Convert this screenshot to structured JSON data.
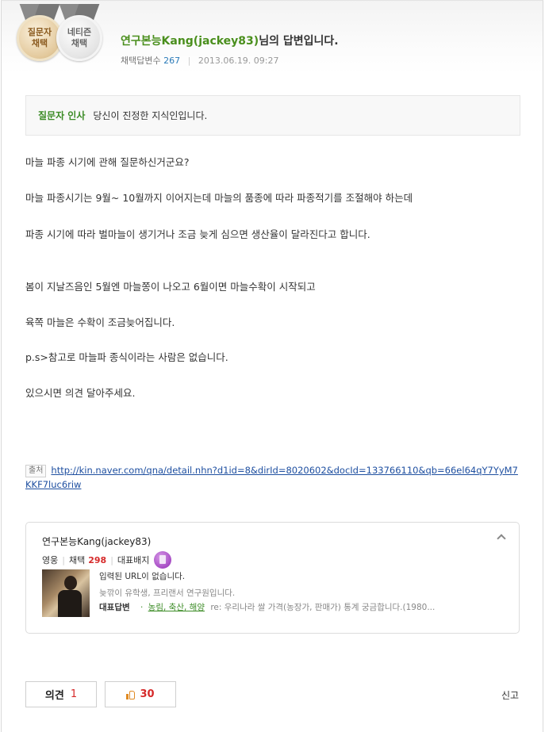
{
  "header": {
    "medals": [
      {
        "line1": "질문자",
        "line2": "채택"
      },
      {
        "line1": "네티즌",
        "line2": "채택"
      }
    ],
    "answerer_name": "연구본능Kang(jackey83)",
    "title_suffix": "님의 답변입니다.",
    "adopted_label": "채택답변수",
    "adopted_count": "267",
    "date": "2013.06.19.  09:27"
  },
  "greeting": {
    "label": "질문자 인사",
    "text": "당신이 진정한 지식인입니다."
  },
  "body": {
    "paragraphs": [
      "마늘 파종 시기에 관해 질문하신거군요?",
      "마늘 파종시기는 9월~ 10월까지 이어지는데 마늘의 품종에 따라 파종적기를 조절해야 하는데",
      "파종 시기에 따라 벌마늘이 생기거나 조금 늦게 심으면 생산율이 달라진다고 합니다.",
      "봄이 지날즈음인 5월엔 마늘쫑이 나오고 6월이면 마늘수확이 시작되고",
      "육쪽 마늘은 수확이 조금늦어집니다.",
      "p.s>참고로 마늘파 종식이라는 사람은 없습니다.",
      "있으시면 의견 달아주세요."
    ]
  },
  "source": {
    "tag": "출처",
    "url": "http://kin.naver.com/qna/detail.nhn?d1id=8&dirId=8020602&docId=133766110&qb=66el64qY7YyM7KKF7luc6riw"
  },
  "profile": {
    "name": "연구본능Kang(jackey83)",
    "rank": "영웅",
    "adopt_label": "채택",
    "adopt_count": "298",
    "badge_label": "대표배지",
    "badge_icon": "badge-icon",
    "url_text": "입력된 URL이 없습니다.",
    "intro": "늦깎이 유학생, 프리랜서 연구원입니다.",
    "rep_label": "대표답변",
    "rep_bullet": "·",
    "rep_category": "농림, 축산, 해양",
    "rep_question": "re: 우리나라 쌀 가격(농장가, 판매가) 통계 궁금합니다.(1980..."
  },
  "footer": {
    "opinion_label": "의견",
    "opinion_count": "1",
    "like_count": "30",
    "report_label": "신고"
  }
}
